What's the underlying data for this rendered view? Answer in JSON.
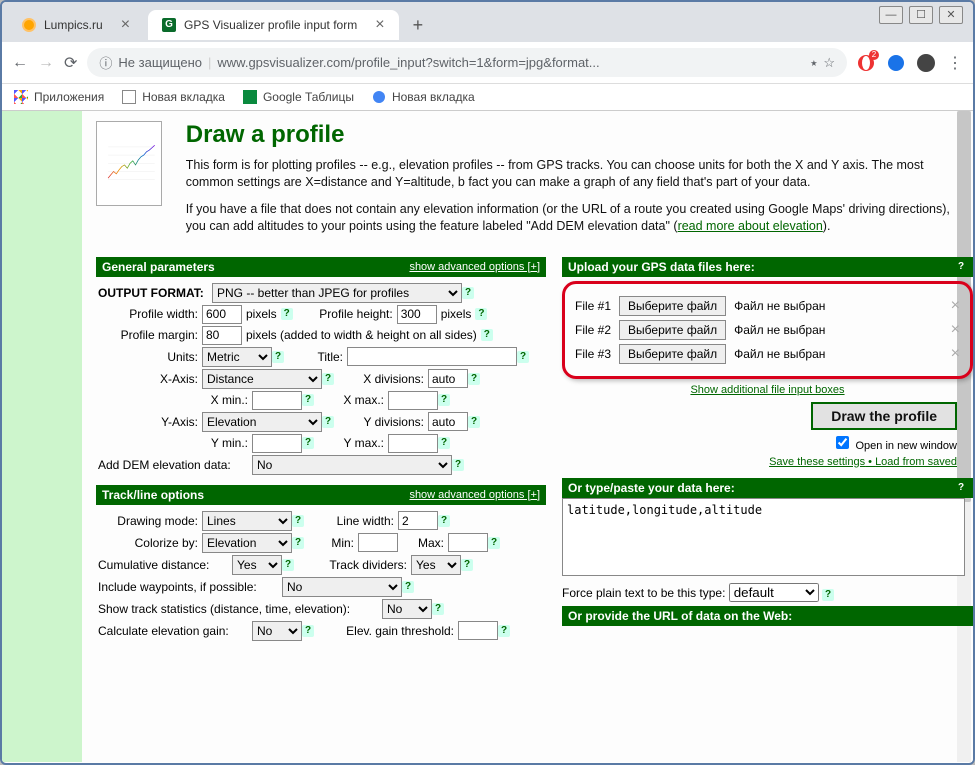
{
  "win": {
    "min": "—",
    "max": "☐",
    "close": "✕"
  },
  "tabs": [
    {
      "title": "Lumpics.ru",
      "active": false
    },
    {
      "title": "GPS Visualizer profile input form",
      "active": true
    }
  ],
  "address": {
    "insecure": "Не защищено",
    "url": "www.gpsvisualizer.com/profile_input?switch=1&form=jpg&format..."
  },
  "bookmarks": {
    "apps": "Приложения",
    "newtab1": "Новая вкладка",
    "sheets": "Google Таблицы",
    "newtab2": "Новая вкладка"
  },
  "intro": {
    "title": "Draw a profile",
    "p1": "This form is for plotting profiles -- e.g., elevation profiles -- from GPS tracks. You can choose units for both the X and Y axis. The most common settings are X=distance and Y=altitude, b fact you can make a graph of any field that's part of your data.",
    "p2a": "If you have a file that does not contain any elevation information (or the URL of a route you created using Google Maps' driving directions), you can add altitudes to your points using the feature labeled \"Add DEM elevation data\" (",
    "p2link": "read more about elevation",
    "p2b": ")."
  },
  "chart_data": {
    "type": "line",
    "title": "",
    "xlabel": "",
    "ylabel": "",
    "x": [
      0,
      10,
      20,
      30,
      40,
      50,
      60,
      70,
      80,
      90,
      100,
      110,
      120,
      130,
      140,
      150,
      160,
      170
    ],
    "y": [
      600,
      800,
      1000,
      860,
      1100,
      1300,
      1400,
      1200,
      1500,
      1650,
      1400,
      1700,
      1900,
      2000,
      2200,
      2300,
      2450,
      2600
    ],
    "ylim": [
      500,
      2600
    ]
  },
  "sections": {
    "general": "General parameters",
    "track": "Track/line options",
    "upload": "Upload your GPS data files here:",
    "paste": "Or type/paste your data here:",
    "url": "Or provide the URL of data on the Web:",
    "adv": "show advanced options [+]"
  },
  "general": {
    "output_label": "OUTPUT FORMAT:",
    "output_value": "PNG -- better than JPEG for profiles",
    "width_label": "Profile width:",
    "width_val": "600",
    "px": "pixels",
    "height_label": "Profile height:",
    "height_val": "300",
    "margin_label": "Profile margin:",
    "margin_val": "80",
    "margin_note": "pixels (added to width & height on all sides)",
    "units_label": "Units:",
    "units_val": "Metric",
    "title_label": "Title:",
    "title_val": "",
    "xaxis_label": "X-Axis:",
    "xaxis_val": "Distance",
    "xdiv_label": "X divisions:",
    "xdiv_val": "auto",
    "xmin_label": "X min.:",
    "xmax_label": "X max.:",
    "yaxis_label": "Y-Axis:",
    "yaxis_val": "Elevation",
    "ydiv_label": "Y divisions:",
    "ydiv_val": "auto",
    "ymin_label": "Y min.:",
    "ymax_label": "Y max.:",
    "dem_label": "Add DEM elevation data:",
    "dem_val": "No"
  },
  "track": {
    "mode_label": "Drawing mode:",
    "mode_val": "Lines",
    "lwidth_label": "Line width:",
    "lwidth_val": "2",
    "color_label": "Colorize by:",
    "color_val": "Elevation",
    "min_label": "Min:",
    "max_label": "Max:",
    "cum_label": "Cumulative distance:",
    "cum_val": "Yes",
    "div_label": "Track dividers:",
    "div_val": "Yes",
    "wpt_label": "Include waypoints, if possible:",
    "wpt_val": "No",
    "stats_label": "Show track statistics (distance, time, elevation):",
    "stats_val": "No",
    "gain_label": "Calculate elevation gain:",
    "gain_val": "No",
    "thresh_label": "Elev. gain threshold:"
  },
  "upload": {
    "file_labels": [
      "File #1",
      "File #2",
      "File #3"
    ],
    "choose": "Выберите файл",
    "nofile": "Файл не выбран",
    "more": "Show additional file input boxes"
  },
  "draw": {
    "button": "Draw the profile",
    "newwin": "Open in new window",
    "save": "Save these settings",
    "sep": " • ",
    "load": "Load from saved"
  },
  "paste": {
    "content": "latitude,longitude,altitude",
    "force_label": "Force plain text to be this type:",
    "force_val": "default"
  }
}
